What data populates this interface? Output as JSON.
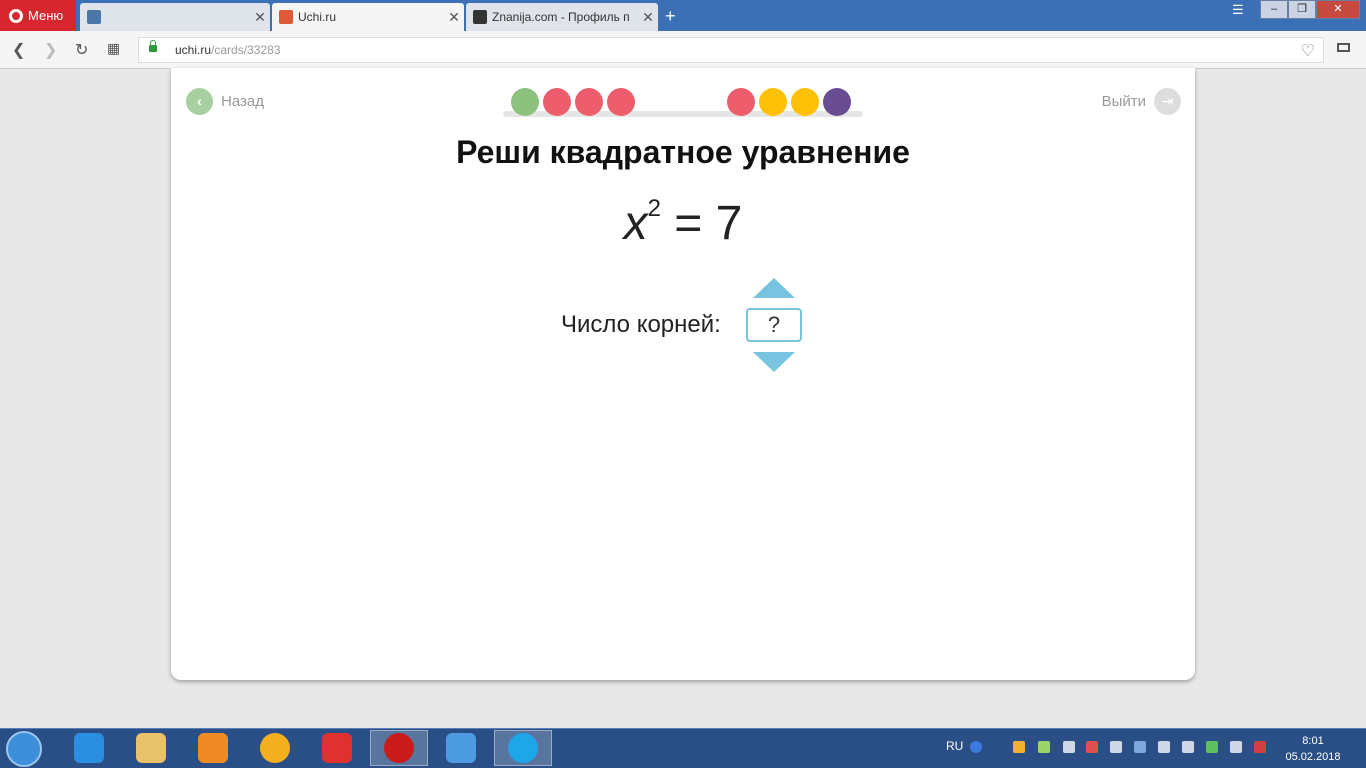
{
  "browser": {
    "menu_label": "Меню",
    "tabs": [
      {
        "title": "",
        "favicon_color": "#4a76a8"
      },
      {
        "title": "Uchi.ru",
        "favicon_color": "#e05a3a"
      },
      {
        "title": "Znanija.com - Профиль п",
        "favicon_color": "#333333"
      }
    ],
    "new_tab": "+",
    "close_glyph": "✕",
    "window_controls": {
      "minimize": "–",
      "maximize": "❐",
      "close": "✕"
    },
    "url_host": "uchi.ru",
    "url_path": "/cards/33283"
  },
  "page": {
    "back_label": "Назад",
    "exit_label": "Выйти",
    "title": "Реши квадратное уравнение",
    "equation": {
      "variable": "x",
      "exponent": "2",
      "rest": " = 7"
    },
    "roots_label": "Число корней:",
    "answer_value": "?",
    "progress_dots": [
      {
        "color": "#8cc27e"
      },
      {
        "color": "#ee5d6c"
      },
      {
        "color": "#ee5d6c"
      },
      {
        "color": "#ee5d6c"
      },
      {
        "color": "#ee5d6c"
      },
      {
        "color": "#ffc107"
      },
      {
        "color": "#ffc107"
      },
      {
        "color": "#6a4c93"
      }
    ]
  },
  "taskbar": {
    "apps": [
      {
        "name": "internet-explorer",
        "color": "#2a8fe0"
      },
      {
        "name": "file-explorer",
        "color": "#e8c26a"
      },
      {
        "name": "media-player",
        "color": "#f08a24"
      },
      {
        "name": "aimp",
        "color": "#f2b01e"
      },
      {
        "name": "yandex-browser",
        "color": "#e03131"
      },
      {
        "name": "opera",
        "color": "#cc1b1b"
      },
      {
        "name": "audio",
        "color": "#4d9be0"
      },
      {
        "name": "skype",
        "color": "#1ea7e8"
      }
    ],
    "language": "RU",
    "time": "8:01",
    "date": "05.02.2018"
  }
}
